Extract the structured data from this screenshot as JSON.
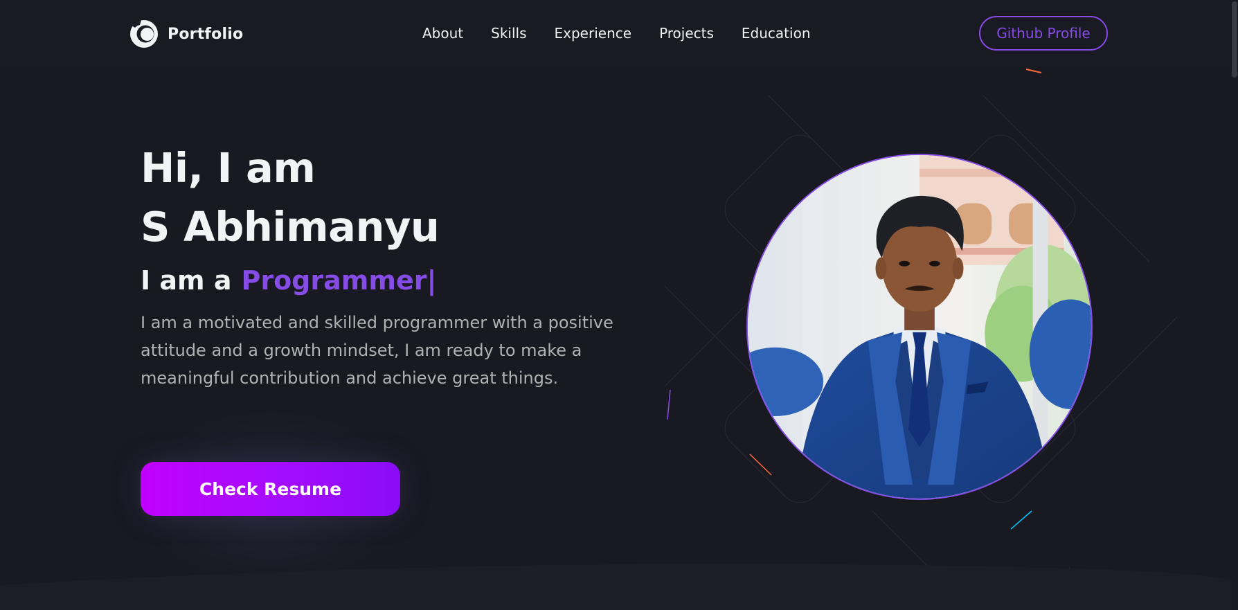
{
  "navbar": {
    "logo_text": "Portfolio",
    "links": [
      {
        "label": "About"
      },
      {
        "label": "Skills"
      },
      {
        "label": "Experience"
      },
      {
        "label": "Projects"
      },
      {
        "label": "Education"
      }
    ],
    "github_label": "Github Profile"
  },
  "hero": {
    "title_line1": "Hi, I am",
    "title_line2": "S Abhimanyu",
    "role_prefix": "I am a",
    "role_value": "Programmer|",
    "description": "I am a motivated and skilled programmer with a positive attitude and a growth mindset, I am ready to make a meaningful contribution and achieve great things.",
    "resume_label": "Check Resume"
  },
  "colors": {
    "background": "#191922",
    "accent": "#854ce6",
    "text_primary": "#f2f3f4",
    "text_secondary": "#b1b2b3",
    "button_gradient_start": "#c100ff",
    "button_gradient_end": "#8a0cf7"
  },
  "icons": {
    "logo": "crescent-logo-icon",
    "photo": "profile-photo"
  }
}
